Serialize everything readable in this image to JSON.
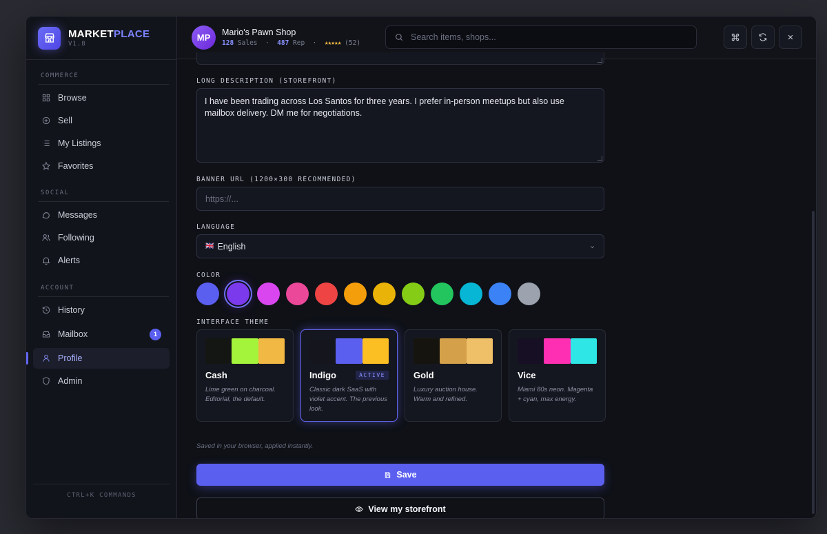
{
  "brand": {
    "name_main": "MARKET",
    "name_accent": "PLACE",
    "version": "V1.8"
  },
  "sidebar": {
    "sections": {
      "commerce": "COMMERCE",
      "social": "SOCIAL",
      "account": "ACCOUNT"
    },
    "items": [
      {
        "label": "Browse",
        "icon": "grid-icon"
      },
      {
        "label": "Sell",
        "icon": "plus-circle-icon"
      },
      {
        "label": "My Listings",
        "icon": "list-icon"
      },
      {
        "label": "Favorites",
        "icon": "star-icon"
      },
      {
        "label": "Messages",
        "icon": "chat-icon"
      },
      {
        "label": "Following",
        "icon": "users-icon"
      },
      {
        "label": "Alerts",
        "icon": "bell-icon"
      },
      {
        "label": "History",
        "icon": "history-icon"
      },
      {
        "label": "Mailbox",
        "icon": "inbox-icon",
        "badge": "1"
      },
      {
        "label": "Profile",
        "icon": "user-icon",
        "active": true
      },
      {
        "label": "Admin",
        "icon": "shield-icon"
      }
    ],
    "footer": "CTRL+K COMMANDS"
  },
  "header": {
    "avatar_initials": "MP",
    "shop_name": "Mario's Pawn Shop",
    "sales_count": "128",
    "sales_label": "Sales",
    "rep_count": "487",
    "rep_label": "Rep",
    "stars": "★★★★★",
    "review_count": "(52)",
    "search_placeholder": "Search items, shops..."
  },
  "form": {
    "long_desc_label": "LONG DESCRIPTION (STOREFRONT)",
    "long_desc_value": "I have been trading across Los Santos for three years. I prefer in-person meetups but also use mailbox delivery. DM me for negotiations.",
    "banner_label": "BANNER URL (1200×300 RECOMMENDED)",
    "banner_placeholder": "https://...",
    "language_label": "LANGUAGE",
    "language_flag": "🇬🇧",
    "language_value": "English",
    "color_label": "COLOR",
    "colors": [
      "#5b5ff0",
      "#7c3aed",
      "#d946ef",
      "#ec4899",
      "#ef4444",
      "#f59e0b",
      "#eab308",
      "#84cc16",
      "#22c55e",
      "#06b6d4",
      "#3b82f6",
      "#9ca3af"
    ],
    "selected_color_index": 1,
    "theme_label": "INTERFACE THEME",
    "themes": [
      {
        "name": "Cash",
        "desc": "Lime green on charcoal. Editorial, the default.",
        "colors": [
          "#141614",
          "#a3f43a",
          "#f2b844"
        ]
      },
      {
        "name": "Indigo",
        "desc": "Classic dark SaaS with violet accent. The previous look.",
        "colors": [
          "#15161d",
          "#5b5ff0",
          "#fbbf24"
        ],
        "active_tag": "ACTIVE"
      },
      {
        "name": "Gold",
        "desc": "Luxury auction house. Warm and refined.",
        "colors": [
          "#16140f",
          "#d4a04a",
          "#f0c068"
        ]
      },
      {
        "name": "Vice",
        "desc": "Miami 80s neon. Magenta + cyan, max energy.",
        "colors": [
          "#170f24",
          "#ff2fb3",
          "#2ee6e6"
        ]
      }
    ],
    "saved_note": "Saved in your browser, applied instantly.",
    "save_label": "Save",
    "storefront_label": "View my storefront"
  }
}
